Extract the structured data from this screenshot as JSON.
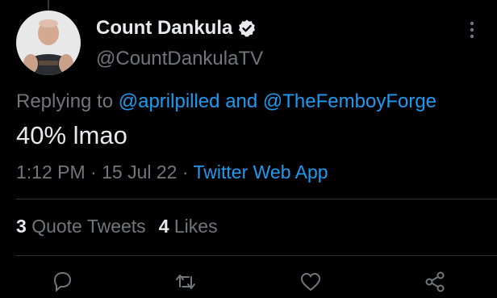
{
  "tweet": {
    "author": {
      "display_name": "Count Dankula",
      "handle": "@CountDankulaTV",
      "verified": true
    },
    "reply_context": {
      "prefix": "Replying to",
      "mention_1": "@aprilpilled",
      "joiner": "and",
      "mention_2": "@TheFemboyForge"
    },
    "text": "40% lmao",
    "meta": {
      "time": "1:12 PM",
      "separator_1": "·",
      "date": "15 Jul 22",
      "separator_2": "·",
      "source": "Twitter Web App"
    },
    "stats": {
      "quote_tweets_count": "3",
      "quote_tweets_label": "Quote Tweets",
      "likes_count": "4",
      "likes_label": "Likes"
    }
  },
  "actions": [
    "reply-icon",
    "retweet-icon",
    "like-icon",
    "share-icon"
  ],
  "colors": {
    "background": "#000000",
    "primary_text": "#e7e9ea",
    "secondary_text": "#71767b",
    "link": "#1d9bf0",
    "divider": "#2f3336"
  }
}
